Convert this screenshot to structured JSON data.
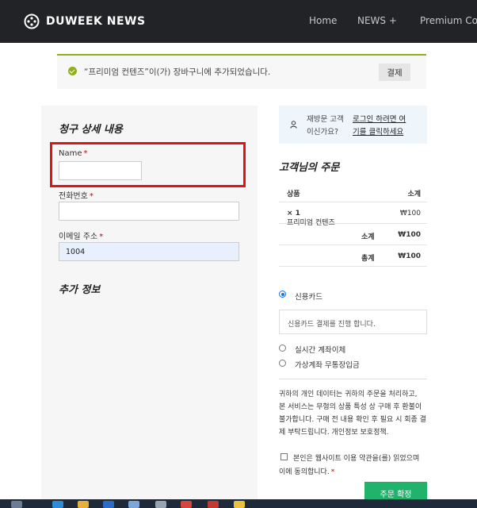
{
  "header": {
    "logo_text": "DUWEEK NEWS",
    "nav": [
      {
        "label": "Home"
      },
      {
        "label": "NEWS  +"
      },
      {
        "label": "Premium Co"
      }
    ]
  },
  "notice": {
    "message": "“프리미엄 컨텐즈”이(가) 장바구니에 추가되었습니다.",
    "button": "결제"
  },
  "billing": {
    "title": "청구 상세 내용",
    "fields": [
      {
        "label": "Name",
        "required": "*",
        "value": ""
      },
      {
        "label": "전화번호",
        "required": "*",
        "value": ""
      },
      {
        "label": "이메일 주소",
        "required": "*",
        "value": "1004"
      }
    ],
    "additional_title": "추가 정보"
  },
  "returning": {
    "q1": "재방문 고객",
    "q2": "이신가요?",
    "link1": "로그인 하려면 여",
    "link2": "기를 클릭하세요"
  },
  "order": {
    "title": "고객님의 주문",
    "head_product": "상품",
    "head_total": "소계",
    "item_name": "프리미엄 컨텐즈",
    "item_qty": "× 1",
    "item_price": "₩100",
    "subtotal_label": "소계",
    "subtotal_value": "₩100",
    "total_label": "총계",
    "total_value": "₩100"
  },
  "payment": {
    "options": [
      {
        "label": "신용카드",
        "selected": true
      },
      {
        "label": "실시간 계좌이체",
        "selected": false
      },
      {
        "label": "가상계좌 무통장입금",
        "selected": false
      }
    ],
    "card_desc": "신용카드 결제를 진행 합니다.",
    "privacy": [
      "귀하의 개인 데이터는 귀하의 주문을 처리하고,",
      "본 서비스는 무형의 상품 특성 상 구매 후 환불이",
      "불가합니다. 구매 전 내용 확인 후 필요 시 회종 결",
      "제 부탁드립니다. 개인정보 보호정책."
    ],
    "agree1": "본인은 웹사이트 이용 약관을(를) 읽었으며",
    "agree2": "이에 동의합니다.",
    "agree_req": "*",
    "confirm": "주문 확정"
  },
  "colors": {
    "header_bg": "#222326",
    "accent_green": "#8fae1b",
    "confirm_green": "#21b36b",
    "highlight_red": "#e01414"
  }
}
